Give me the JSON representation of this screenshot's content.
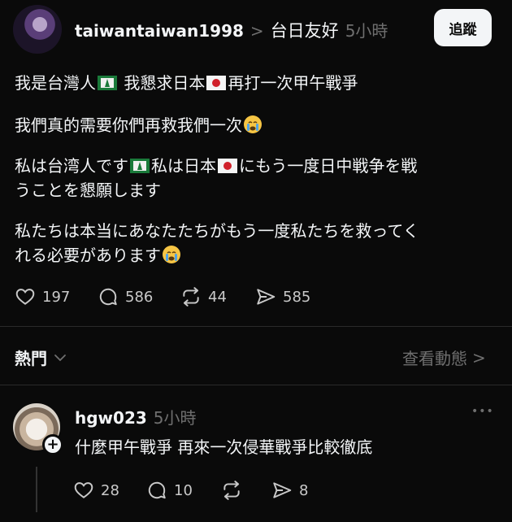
{
  "post": {
    "username": "taiwantaiwan1998",
    "topic_chevron": ">",
    "topic": "台日友好",
    "time": "5小時",
    "follow_label": "追蹤",
    "lines": [
      "我是台灣人",
      "我懇求日本",
      "再打一次甲午戰爭",
      "我們真的需要你們再救我們一次",
      "私は台湾人です",
      "私は日本",
      "にもう一度日中戦争を戦",
      "うことを懇願します",
      "私たちは本当にあなたたちがもう一度私たちを救ってく",
      "れる必要があります"
    ],
    "stats": {
      "likes": "197",
      "comments": "586",
      "reposts": "44",
      "shares": "585"
    }
  },
  "sort": {
    "label": "熱門",
    "activity_link": "查看動態",
    "activity_chevron": ">"
  },
  "reply": {
    "username": "hgw023",
    "time": "5小時",
    "text": "什麼甲午戰爭 再來一次侵華戰爭比較徹底",
    "more": "•••",
    "plus": "+",
    "stats": {
      "likes": "28",
      "comments": "10",
      "shares": "8"
    }
  },
  "colors": {
    "background": "#0a0a0a",
    "text": "#f3f5f7",
    "muted": "#6f6f6f",
    "divider": "#2a2a2a",
    "button_bg": "#f3f5f7"
  },
  "icons": [
    "heart-icon",
    "comment-icon",
    "repost-icon",
    "share-icon",
    "chevron-down-icon",
    "chevron-right-icon",
    "more-icon",
    "plus-icon",
    "flag-taiwan-icon",
    "flag-japan-icon",
    "crying-face-icon"
  ]
}
